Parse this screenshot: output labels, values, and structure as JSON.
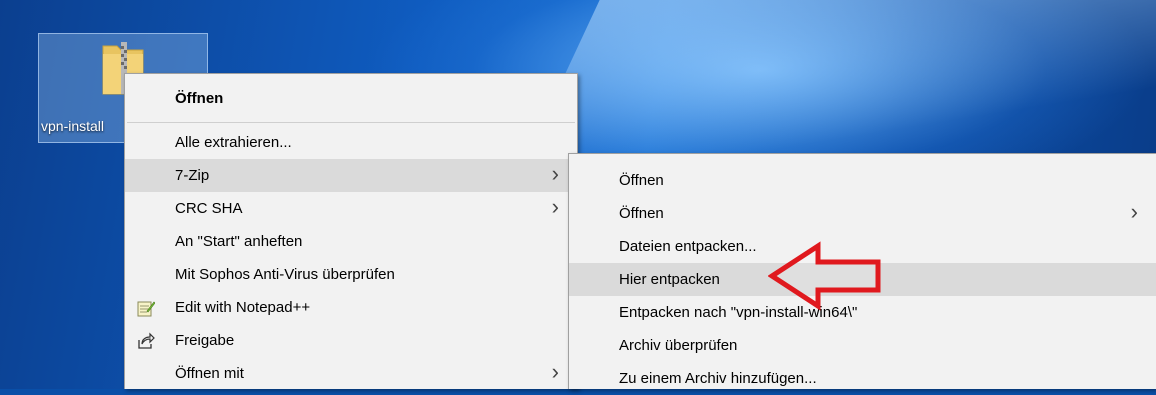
{
  "desktop": {
    "icon_label": "vpn-install"
  },
  "context_menu": {
    "items": [
      {
        "label": "Öffnen",
        "bold": true
      },
      {
        "label": "Alle extrahieren..."
      },
      {
        "label": "7-Zip",
        "has_submenu": true
      },
      {
        "label": "CRC SHA",
        "has_submenu": true
      },
      {
        "label": "An \"Start\" anheften"
      },
      {
        "label": "Mit Sophos Anti-Virus überprüfen"
      },
      {
        "label": "Edit with Notepad++",
        "icon": "notepad-plus-icon"
      },
      {
        "label": "Freigabe",
        "icon": "share-icon"
      },
      {
        "label": "Öffnen mit",
        "has_submenu": true
      }
    ],
    "chevron": "›"
  },
  "submenu_7zip": {
    "items": [
      {
        "label": "Öffnen"
      },
      {
        "label": "Öffnen",
        "has_submenu": true
      },
      {
        "label": "Dateien entpacken..."
      },
      {
        "label": "Hier entpacken",
        "highlighted": true
      },
      {
        "label": "Entpacken nach \"vpn-install-win64\\\""
      },
      {
        "label": "Archiv überprüfen"
      },
      {
        "label": "Zu einem Archiv hinzufügen..."
      }
    ]
  },
  "colors": {
    "menu_bg": "#f2f2f2",
    "highlight": "#dadada",
    "arrow": "#e0191e"
  }
}
